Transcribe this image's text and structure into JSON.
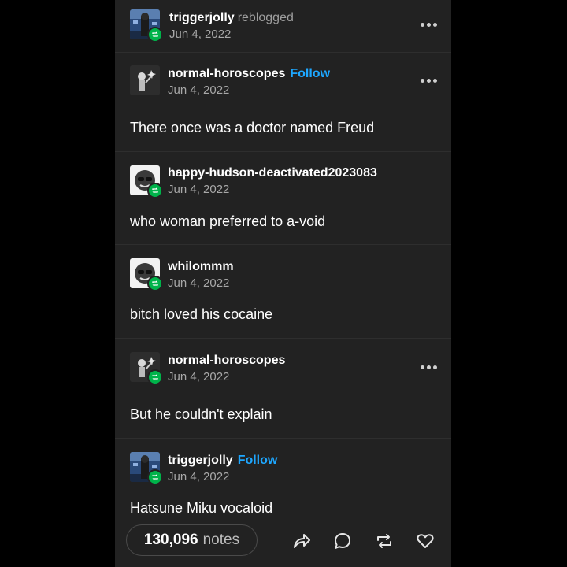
{
  "posts": [
    {
      "username": "triggerjolly",
      "suffix": "reblogged",
      "follow": "",
      "date": "Jun 4, 2022",
      "text": ""
    },
    {
      "username": "normal-horoscopes",
      "suffix": "",
      "follow": "Follow",
      "date": "Jun 4, 2022",
      "text": "There once was a doctor named Freud"
    },
    {
      "username": "happy-hudson-deactivated2023083",
      "suffix": "",
      "follow": "",
      "date": "Jun 4, 2022",
      "text": "who woman preferred to a-void"
    },
    {
      "username": "whilommm",
      "suffix": "",
      "follow": "",
      "date": "Jun 4, 2022",
      "text": "bitch loved his cocaine"
    },
    {
      "username": "normal-horoscopes",
      "suffix": "",
      "follow": "",
      "date": "Jun 4, 2022",
      "text": "But he couldn't explain"
    },
    {
      "username": "triggerjolly",
      "suffix": "",
      "follow": "Follow",
      "date": "Jun 4, 2022",
      "text": "Hatsune Miku vocaloid"
    }
  ],
  "footer": {
    "notes_count": "130,096",
    "notes_label": "notes"
  },
  "icons": {
    "more": "more-options-icon",
    "share": "share-icon",
    "reply": "reply-icon",
    "reblog": "reblog-icon",
    "like": "heart-icon"
  },
  "colors": {
    "background": "#000000",
    "panel": "#222222",
    "follow": "#1ea7ff",
    "reblog_badge": "#00b34a",
    "muted_text": "#a8a8a8"
  }
}
